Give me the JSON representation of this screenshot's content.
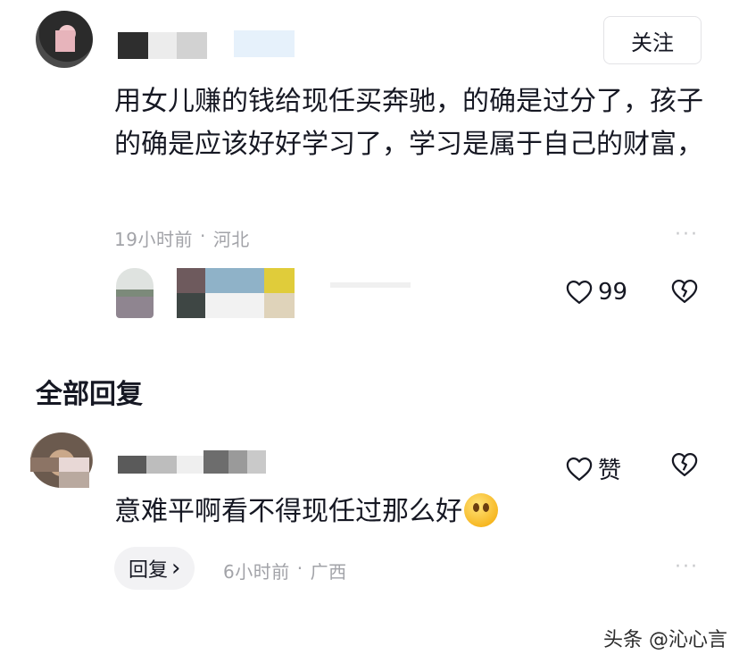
{
  "comment": {
    "follow_label": "关注",
    "text": "用女儿赚的钱给现任买奔驰，的确是过分了，孩子的确是应该好好学习了，学习是属于自己的财富，",
    "time": "19小时前",
    "separator": "·",
    "location": "河北",
    "like_count": "99",
    "more": "···"
  },
  "replies_section": {
    "title": "全部回复"
  },
  "reply": {
    "like_label": "赞",
    "text": "意难平啊看不得现任过那么好",
    "emoji": "shushing-face-emoji",
    "reply_button_label": "回复",
    "reply_chevron": "›",
    "time": "6小时前",
    "separator": "·",
    "location": "广西",
    "more": "···"
  },
  "watermark": "头条 @沁心言",
  "colors": {
    "primary_text": "#161823",
    "secondary_text": "#a2a3a8",
    "button_bg": "#f2f2f4",
    "divider": "#e3e3e6"
  }
}
